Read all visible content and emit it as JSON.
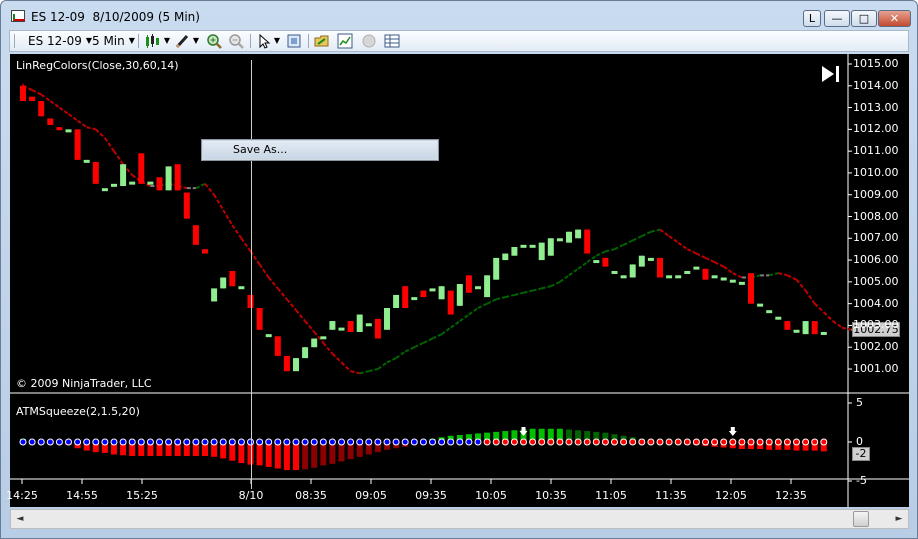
{
  "window": {
    "title": "ES 12-09  8/10/2009 (5 Min)",
    "buttons": {
      "l": "L",
      "minimize": "—",
      "maximize": "□",
      "close": "✕"
    }
  },
  "toolbar": {
    "instrument": "ES 12-09",
    "interval": "5 Min",
    "icons": [
      "candlestick-icon",
      "pencil-icon",
      "zoom-in-icon",
      "zoom-out-icon",
      "cursor-icon",
      "data-box-icon",
      "folder-icon",
      "chart-properties-icon",
      "disabled-icon",
      "table-icon"
    ]
  },
  "chart": {
    "price_indicator_label": "LinRegColors(Close,30,60,14)",
    "copyright": "© 2009 NinjaTrader, LLC",
    "indicator_label": "ATMSqueeze(2,1.5,20)",
    "price_axis": [
      "1015.00",
      "1014.00",
      "1013.00",
      "1012.00",
      "1011.00",
      "1010.00",
      "1009.00",
      "1008.00",
      "1007.00",
      "1006.00",
      "1005.00",
      "1004.00",
      "1003.00",
      "1002.00",
      "1001.00"
    ],
    "indicator_axis": [
      "5",
      "0",
      "-5"
    ],
    "time_axis": [
      "14:25",
      "14:55",
      "15:25",
      "8/10",
      "08:35",
      "09:05",
      "09:35",
      "10:05",
      "10:35",
      "11:05",
      "11:35",
      "12:05",
      "12:35"
    ],
    "last_price": "1002.75",
    "indicator_value": "-2",
    "colors": {
      "up": "#90ee90",
      "down": "#ff0000",
      "bg": "#000000",
      "line_down": "#c00000",
      "line_flat": "#808080",
      "line_up": "#006400",
      "squeeze_on": "#ff0000",
      "squeeze_off": "#0000ff"
    }
  },
  "context_menu": {
    "item": "Save As..."
  },
  "scrollbar": {
    "left": "◄",
    "right": "►"
  },
  "chart_data": {
    "type": "candlestick",
    "price_ylim": [
      1000.5,
      1015.0
    ],
    "indicator_ylim": [
      -5,
      5
    ],
    "bars": [
      {
        "o": 1014.0,
        "c": 1013.3,
        "h": 1014.1,
        "l": 1013.3
      },
      {
        "o": 1013.5,
        "c": 1013.3,
        "h": 1013.5,
        "l": 1013.3
      },
      {
        "o": 1013.3,
        "c": 1012.6,
        "h": 1013.3,
        "l": 1012.6
      },
      {
        "o": 1012.5,
        "c": 1012.2,
        "h": 1012.5,
        "l": 1012.2
      },
      {
        "o": 1012.1,
        "c": 1012.0,
        "h": 1012.1,
        "l": 1012.0
      },
      {
        "o": 1012.0,
        "c": 1012.0,
        "h": 1012.0,
        "l": 1012.0
      },
      {
        "o": 1012.0,
        "c": 1010.6,
        "h": 1012.0,
        "l": 1010.6
      },
      {
        "o": 1010.6,
        "c": 1010.6,
        "h": 1010.6,
        "l": 1010.6
      },
      {
        "o": 1010.5,
        "c": 1009.5,
        "h": 1010.5,
        "l": 1009.5
      },
      {
        "o": 1009.3,
        "c": 1009.3,
        "h": 1009.3,
        "l": 1009.3
      },
      {
        "o": 1009.5,
        "c": 1009.5,
        "h": 1009.5,
        "l": 1009.5
      },
      {
        "o": 1009.4,
        "c": 1010.4,
        "h": 1010.4,
        "l": 1009.4
      },
      {
        "o": 1009.6,
        "c": 1009.6,
        "h": 1009.6,
        "l": 1009.6
      },
      {
        "o": 1010.9,
        "c": 1009.5,
        "h": 1010.9,
        "l": 1009.5
      },
      {
        "o": 1009.6,
        "c": 1009.6,
        "h": 1009.6,
        "l": 1009.6
      },
      {
        "o": 1009.8,
        "c": 1009.2,
        "h": 1009.8,
        "l": 1009.2
      },
      {
        "o": 1009.2,
        "c": 1010.3,
        "h": 1010.3,
        "l": 1009.2
      },
      {
        "o": 1010.4,
        "c": 1009.2,
        "h": 1010.4,
        "l": 1009.2
      },
      {
        "o": 1009.1,
        "c": 1007.9,
        "h": 1009.1,
        "l": 1007.9
      },
      {
        "o": 1007.6,
        "c": 1006.7,
        "h": 1007.6,
        "l": 1006.7
      },
      {
        "o": 1006.5,
        "c": 1006.3,
        "h": 1006.5,
        "l": 1006.3
      },
      {
        "o": 1004.1,
        "c": 1004.7,
        "h": 1004.7,
        "l": 1004.1
      },
      {
        "o": 1004.7,
        "c": 1005.2,
        "h": 1005.2,
        "l": 1004.7
      },
      {
        "o": 1005.5,
        "c": 1004.8,
        "h": 1005.5,
        "l": 1004.8
      },
      {
        "o": 1004.8,
        "c": 1004.8,
        "h": 1004.8,
        "l": 1004.8
      },
      {
        "o": 1004.4,
        "c": 1003.8,
        "h": 1004.4,
        "l": 1003.8
      },
      {
        "o": 1003.8,
        "c": 1002.8,
        "h": 1003.8,
        "l": 1002.8
      },
      {
        "o": 1002.6,
        "c": 1002.6,
        "h": 1002.6,
        "l": 1002.6
      },
      {
        "o": 1002.5,
        "c": 1001.6,
        "h": 1002.5,
        "l": 1001.6
      },
      {
        "o": 1001.6,
        "c": 1000.9,
        "h": 1001.6,
        "l": 1000.9
      },
      {
        "o": 1000.9,
        "c": 1001.5,
        "h": 1001.5,
        "l": 1000.9
      },
      {
        "o": 1001.5,
        "c": 1002.0,
        "h": 1002.0,
        "l": 1001.5
      },
      {
        "o": 1002.0,
        "c": 1002.4,
        "h": 1002.4,
        "l": 1002.0
      },
      {
        "o": 1002.5,
        "c": 1002.5,
        "h": 1002.5,
        "l": 1002.5
      },
      {
        "o": 1002.8,
        "c": 1003.2,
        "h": 1003.2,
        "l": 1002.8
      },
      {
        "o": 1002.9,
        "c": 1002.9,
        "h": 1002.9,
        "l": 1002.9
      },
      {
        "o": 1003.2,
        "c": 1002.7,
        "h": 1003.2,
        "l": 1002.7
      },
      {
        "o": 1002.7,
        "c": 1003.5,
        "h": 1003.5,
        "l": 1002.7
      },
      {
        "o": 1003.1,
        "c": 1003.1,
        "h": 1003.1,
        "l": 1003.1
      },
      {
        "o": 1003.3,
        "c": 1002.4,
        "h": 1003.3,
        "l": 1002.4
      },
      {
        "o": 1002.8,
        "c": 1003.8,
        "h": 1003.8,
        "l": 1002.8
      },
      {
        "o": 1003.8,
        "c": 1004.4,
        "h": 1004.4,
        "l": 1003.8
      },
      {
        "o": 1004.8,
        "c": 1003.8,
        "h": 1004.8,
        "l": 1003.8
      },
      {
        "o": 1004.3,
        "c": 1004.3,
        "h": 1004.3,
        "l": 1004.3
      },
      {
        "o": 1004.6,
        "c": 1004.3,
        "h": 1004.6,
        "l": 1004.3
      },
      {
        "o": 1004.7,
        "c": 1004.7,
        "h": 1004.7,
        "l": 1004.7
      },
      {
        "o": 1004.2,
        "c": 1004.8,
        "h": 1004.8,
        "l": 1004.2
      },
      {
        "o": 1004.6,
        "c": 1003.5,
        "h": 1004.6,
        "l": 1003.5
      },
      {
        "o": 1003.9,
        "c": 1004.9,
        "h": 1004.9,
        "l": 1003.9
      },
      {
        "o": 1005.3,
        "c": 1004.5,
        "h": 1005.3,
        "l": 1004.5
      },
      {
        "o": 1004.8,
        "c": 1004.8,
        "h": 1004.8,
        "l": 1004.8
      },
      {
        "o": 1004.3,
        "c": 1005.3,
        "h": 1005.3,
        "l": 1004.3
      },
      {
        "o": 1005.1,
        "c": 1006.1,
        "h": 1006.1,
        "l": 1005.1
      },
      {
        "o": 1006.0,
        "c": 1006.3,
        "h": 1006.3,
        "l": 1006.0
      },
      {
        "o": 1006.2,
        "c": 1006.6,
        "h": 1006.6,
        "l": 1006.2
      },
      {
        "o": 1006.7,
        "c": 1006.7,
        "h": 1006.7,
        "l": 1006.7
      },
      {
        "o": 1006.7,
        "c": 1006.7,
        "h": 1006.7,
        "l": 1006.7
      },
      {
        "o": 1006.0,
        "c": 1006.8,
        "h": 1006.8,
        "l": 1006.0
      },
      {
        "o": 1006.2,
        "c": 1007.0,
        "h": 1007.0,
        "l": 1006.2
      },
      {
        "o": 1007.0,
        "c": 1007.0,
        "h": 1007.0,
        "l": 1007.0
      },
      {
        "o": 1006.8,
        "c": 1007.3,
        "h": 1007.3,
        "l": 1006.8
      },
      {
        "o": 1007.0,
        "c": 1007.4,
        "h": 1007.4,
        "l": 1007.0
      },
      {
        "o": 1007.4,
        "c": 1006.3,
        "h": 1007.4,
        "l": 1006.3
      },
      {
        "o": 1006.0,
        "c": 1006.0,
        "h": 1006.0,
        "l": 1006.0
      },
      {
        "o": 1006.1,
        "c": 1005.7,
        "h": 1006.1,
        "l": 1005.7
      },
      {
        "o": 1005.5,
        "c": 1005.5,
        "h": 1005.5,
        "l": 1005.5
      },
      {
        "o": 1005.3,
        "c": 1005.3,
        "h": 1005.3,
        "l": 1005.3
      },
      {
        "o": 1005.2,
        "c": 1005.8,
        "h": 1005.8,
        "l": 1005.2
      },
      {
        "o": 1005.7,
        "c": 1006.2,
        "h": 1006.2,
        "l": 1005.7
      },
      {
        "o": 1006.1,
        "c": 1006.1,
        "h": 1006.1,
        "l": 1006.1
      },
      {
        "o": 1006.1,
        "c": 1005.2,
        "h": 1006.1,
        "l": 1005.2
      },
      {
        "o": 1005.3,
        "c": 1005.3,
        "h": 1005.3,
        "l": 1005.3
      },
      {
        "o": 1005.3,
        "c": 1005.3,
        "h": 1005.3,
        "l": 1005.3
      },
      {
        "o": 1005.5,
        "c": 1005.5,
        "h": 1005.5,
        "l": 1005.5
      },
      {
        "o": 1005.7,
        "c": 1005.7,
        "h": 1005.7,
        "l": 1005.7
      },
      {
        "o": 1005.6,
        "c": 1005.1,
        "h": 1005.6,
        "l": 1005.1
      },
      {
        "o": 1005.3,
        "c": 1005.3,
        "h": 1005.3,
        "l": 1005.3
      },
      {
        "o": 1005.2,
        "c": 1005.2,
        "h": 1005.2,
        "l": 1005.2
      },
      {
        "o": 1005.1,
        "c": 1005.1,
        "h": 1005.1,
        "l": 1005.1
      },
      {
        "o": 1005.0,
        "c": 1005.0,
        "h": 1005.0,
        "l": 1005.0
      },
      {
        "o": 1005.4,
        "c": 1004.0,
        "h": 1005.4,
        "l": 1004.0
      },
      {
        "o": 1004.0,
        "c": 1004.0,
        "h": 1004.0,
        "l": 1004.0
      },
      {
        "o": 1003.7,
        "c": 1003.7,
        "h": 1003.7,
        "l": 1003.7
      },
      {
        "o": 1003.4,
        "c": 1003.4,
        "h": 1003.4,
        "l": 1003.4
      },
      {
        "o": 1003.2,
        "c": 1002.8,
        "h": 1003.2,
        "l": 1002.8
      },
      {
        "o": 1002.8,
        "c": 1002.8,
        "h": 1002.8,
        "l": 1002.8
      },
      {
        "o": 1002.6,
        "c": 1003.2,
        "h": 1003.2,
        "l": 1002.6
      },
      {
        "o": 1003.2,
        "c": 1002.6,
        "h": 1003.2,
        "l": 1002.6
      },
      {
        "o": 1002.7,
        "c": 1002.7,
        "h": 1002.7,
        "l": 1002.7
      }
    ],
    "linreg": [
      1014.0,
      1013.8,
      1013.6,
      1013.3,
      1013.0,
      1012.7,
      1012.4,
      1012.1,
      1012.0,
      1011.6,
      1011.0,
      1010.4,
      1009.9,
      1009.6,
      1009.4,
      1009.4,
      1009.5,
      1009.4,
      1009.3,
      1009.3,
      1009.5,
      1009.0,
      1008.3,
      1007.6,
      1007.0,
      1006.4,
      1005.8,
      1005.2,
      1004.7,
      1004.2,
      1003.7,
      1003.2,
      1002.7,
      1002.2,
      1001.7,
      1001.3,
      1000.9,
      1000.8,
      1000.9,
      1001.0,
      1001.3,
      1001.5,
      1001.8,
      1002.0,
      1002.2,
      1002.4,
      1002.6,
      1002.9,
      1003.2,
      1003.5,
      1003.8,
      1004.0,
      1004.2,
      1004.3,
      1004.4,
      1004.5,
      1004.6,
      1004.7,
      1004.8,
      1005.0,
      1005.3,
      1005.6,
      1005.9,
      1006.2,
      1006.4,
      1006.5,
      1006.7,
      1006.9,
      1007.1,
      1007.3,
      1007.4,
      1007.1,
      1006.8,
      1006.5,
      1006.3,
      1006.1,
      1005.9,
      1005.7,
      1005.4,
      1005.2,
      1005.2,
      1005.3,
      1005.3,
      1005.4,
      1005.3,
      1005.1,
      1004.6,
      1004.0,
      1003.6,
      1003.2,
      1002.9,
      1002.8,
      1002.8
    ],
    "squeeze": [
      0.4,
      0.1,
      0.1,
      0.1,
      -0.2,
      -0.4,
      -0.8,
      -1.1,
      -1.3,
      -1.4,
      -1.6,
      -1.7,
      -1.8,
      -1.8,
      -1.8,
      -1.8,
      -1.8,
      -1.8,
      -1.8,
      -1.8,
      -1.8,
      -1.9,
      -2.1,
      -2.4,
      -2.7,
      -2.9,
      -3.0,
      -3.2,
      -3.4,
      -3.6,
      -3.6,
      -3.5,
      -3.3,
      -3.0,
      -2.8,
      -2.5,
      -2.2,
      -1.9,
      -1.6,
      -1.3,
      -1.0,
      -0.8,
      -0.6,
      -0.3,
      0.1,
      0.4,
      0.6,
      0.8,
      0.9,
      1.0,
      1.1,
      1.2,
      1.3,
      1.4,
      1.5,
      1.6,
      1.7,
      1.7,
      1.7,
      1.7,
      1.6,
      1.5,
      1.4,
      1.3,
      1.2,
      1.0,
      0.8,
      0.6,
      0.4,
      0.3,
      0.1,
      -0.1,
      -0.2,
      -0.3,
      -0.4,
      -0.5,
      -0.6,
      -0.7,
      -0.8,
      -0.9,
      -0.9,
      -0.9,
      -1.0,
      -1.0,
      -1.0,
      -1.1,
      -1.1,
      -1.1,
      -1.2
    ],
    "squeeze_dots": "bbbbbbbbbbbbbbbbbbbbbbbbbbbbbbbbbbbbbbbbbbbbbbbbbbbbbbbbbbbbbbbbbrrrrrrrrrrrrrrrrrrrrrrrrrrrrrrrrrrrrrrrrrrrrrrrrr",
    "arrows": [
      55,
      78
    ]
  }
}
